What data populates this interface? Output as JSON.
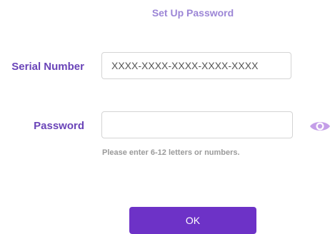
{
  "form": {
    "title": "Set Up Password",
    "serial": {
      "label": "Serial Number",
      "placeholder": "XXXX-XXXX-XXXX-XXXX-XXXX",
      "value": ""
    },
    "password": {
      "label": "Password",
      "placeholder": "",
      "value": "",
      "visibility_icon": "eye-icon",
      "hint": "Please enter 6-12 letters or numbers."
    },
    "ok_label": "OK"
  },
  "colors": {
    "title": "#9c86d6",
    "label": "#6a44b8",
    "button": "#6d32c7",
    "eye_icon": "#c49ee8",
    "hint": "#9a9a9a"
  }
}
